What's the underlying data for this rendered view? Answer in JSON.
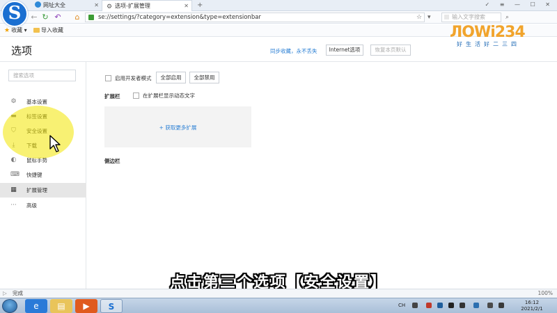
{
  "tabs": [
    {
      "label": "网址大全",
      "active": false
    },
    {
      "label": "选项-扩展管理",
      "active": true
    }
  ],
  "window_controls": "✓ ≡ — ☐ ✕",
  "address": {
    "url": "se://settings/?category=extension&type=extensionbar"
  },
  "search": {
    "placeholder": "输入文字搜索"
  },
  "bookmarks": {
    "favorites": "收藏",
    "import": "导入收藏"
  },
  "watermark": {
    "main": "ЛOWi234",
    "sub": "好生活好二三四"
  },
  "header": {
    "title": "选项",
    "sync_link": "同步收藏，永不丢失",
    "internet_options": "Internet选项",
    "restore_default": "恢复本页默认"
  },
  "sidebar": {
    "search_placeholder": "搜索选项",
    "items": [
      {
        "label": "基本设置",
        "icon": "gear-icon"
      },
      {
        "label": "标签设置",
        "icon": "tab-icon"
      },
      {
        "label": "安全设置",
        "icon": "shield-icon"
      },
      {
        "label": "下载",
        "icon": "download-icon"
      },
      {
        "label": "鼠标手势",
        "icon": "mouse-icon"
      },
      {
        "label": "快捷键",
        "icon": "keyboard-icon"
      },
      {
        "label": "扩展管理",
        "icon": "extensions-icon",
        "active": true
      },
      {
        "label": "高级",
        "icon": "more-icon"
      }
    ]
  },
  "content": {
    "dev_mode": "启用开发者模式",
    "enable_all": "全部启用",
    "disable_all": "全部禁用",
    "extension_bar_label": "扩展栏",
    "show_dynamic_text": "在扩展栏显示动态文字",
    "get_more": "+ 获取更多扩展",
    "sidebar_label": "侧边栏"
  },
  "subtitle": "点击第三个选项【安全设置】",
  "status": {
    "text": "完成",
    "zoom": "100%"
  },
  "taskbar": {
    "time": "16:12",
    "date": "2021/2/1",
    "lang": "CH"
  },
  "colors": {
    "accent": "#2a7fd4",
    "highlight": "#f2e600",
    "active_item_bg": "#e6e6e6"
  }
}
